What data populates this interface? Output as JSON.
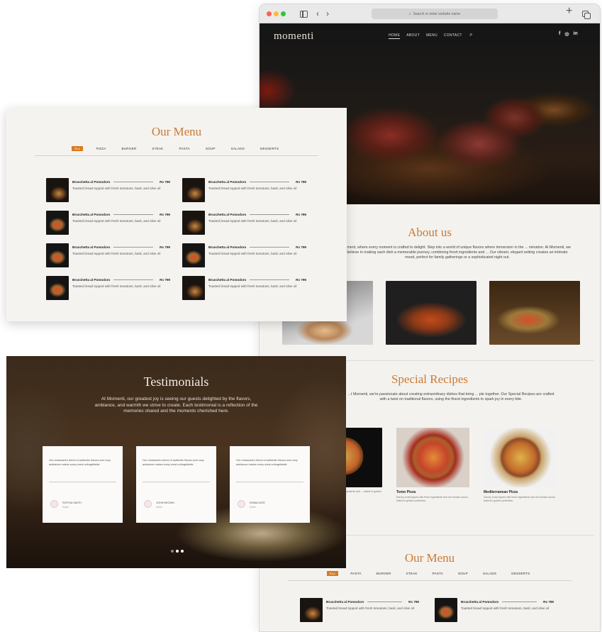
{
  "browser": {
    "url_placeholder": "Search or enter website name"
  },
  "hero": {
    "brand": "momenti",
    "nav": [
      "HOME",
      "ABOUT",
      "MENU",
      "CONTACT"
    ],
    "socials": [
      "f",
      "◎",
      "in"
    ]
  },
  "about": {
    "title": "About us",
    "text": "...ment, where every moment is crafted to delight. Step into a world of unique flavors where immersion in the ... mination. At Momenti, we believe in making each dish a memorable journey, combining fresh ingredients and ... Our vibrant, elegant setting creates an intimate mood, perfect for family gatherings or a sophisticated night out."
  },
  "recipes": {
    "title": "Special Recipes",
    "text": "...t Momenti, we're passionate about creating extraordinary dishes that bring ... ple together. Our Special Recipes are crafted with a twist on traditional flavors, using the finest ingredients to spark joy in every bite.",
    "items": [
      {
        "name": "",
        "desc": "Savory crust topped with fresh ingredients and ... baked to golden perfection."
      },
      {
        "name": "Tomo Pizza",
        "desc": "Savory crust topped with fresh ingredients and rich tomato sauce, baked to golden perfection."
      },
      {
        "name": "Mediterranean Pizza",
        "desc": "Savory crust topped with fresh ingredients and rich tomato sauce, baked to golden perfection."
      }
    ]
  },
  "menu": {
    "title": "Our Menu",
    "filters": [
      "ALL",
      "PIZZA",
      "BURGER",
      "STEAK",
      "PASTA",
      "SOUP",
      "SALADS",
      "DESSERTS"
    ],
    "items": [
      {
        "name": "Bruschetta al Pomodoro",
        "price": "Rs 799",
        "desc": "Toasted bread topped with fresh tomatoes, basil, and olive oil"
      },
      {
        "name": "Bruschetta al Pomodoro",
        "price": "Rs 799",
        "desc": "Toasted bread topped with fresh tomatoes, basil, and olive oil"
      },
      {
        "name": "Bruschetta al Pomodoro",
        "price": "Rs 799",
        "desc": "Toasted bread topped with fresh tomatoes, basil, and olive oil"
      },
      {
        "name": "Bruschetta al Pomodoro",
        "price": "Rs 799",
        "desc": "Toasted bread topped with fresh tomatoes, basil, and olive oil"
      },
      {
        "name": "Bruschetta al Pomodoro",
        "price": "Rs 799",
        "desc": "Toasted bread topped with fresh tomatoes, basil, and olive oil"
      },
      {
        "name": "Bruschetta al Pomodoro",
        "price": "Rs 799",
        "desc": "Toasted bread topped with fresh tomatoes, basil, and olive oil"
      },
      {
        "name": "Bruschetta al Pomodoro",
        "price": "Rs 799",
        "desc": "Toasted bread topped with fresh tomatoes, basil, and olive oil"
      },
      {
        "name": "Bruschetta al Pomodoro",
        "price": "Rs 799",
        "desc": "Toasted bread topped with fresh tomatoes, basil, and olive oil"
      }
    ]
  },
  "bottom_menu": {
    "title": "Our Menu",
    "filters": [
      "ALL",
      "PASTA",
      "BURGER",
      "STEAK",
      "PASTA",
      "SOUP",
      "SALADS",
      "DESSERTS"
    ],
    "items": [
      {
        "name": "Bruschetta al Pomodoro",
        "price": "Rs 799",
        "desc": "Toasted bread topped with fresh tomatoes, basil, and olive oil"
      },
      {
        "name": "Bruschetta al Pomodoro",
        "price": "Rs 799",
        "desc": "Toasted bread topped with fresh tomatoes, basil, and olive oil"
      }
    ]
  },
  "testimonials": {
    "title": "Testimonials",
    "text": "At Momenti, our greatest joy is seeing our guests delighted by the flavors, ambiance, and warmth we strive to create. Each testimonial is a reflection of the memories shared and the moments cherished here.",
    "cards": [
      {
        "quote": "Our restaurant's blend of authentic flavors and cozy ambiance makes every meal unforgettable.",
        "name": "SOPHIA SMITH",
        "role": "Guest"
      },
      {
        "quote": "Our restaurant's blend of authentic flavors and cozy ambiance makes every meal unforgettable.",
        "name": "JOHN BROWN",
        "role": "Guest"
      },
      {
        "quote": "Our restaurant's blend of authentic flavors and cozy ambiance makes every meal unforgettable.",
        "name": "EMMA KATE",
        "role": "Guest"
      }
    ]
  },
  "colors": {
    "accent": "#d87a1e",
    "title": "#c97a34",
    "panel_bg": "#f5f3f0"
  }
}
